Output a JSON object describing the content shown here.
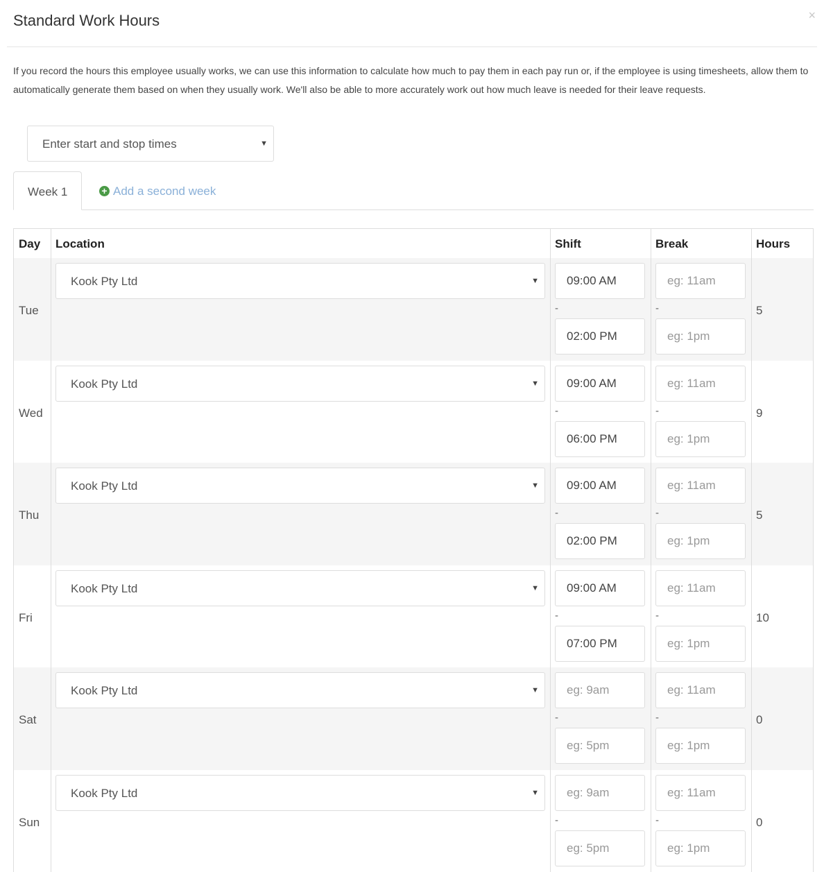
{
  "modal": {
    "title": "Standard Work Hours",
    "close_icon": "×",
    "description": "If you record the hours this employee usually works, we can use this information to calculate how much to pay them in each pay run or, if the employee is using timesheets, allow them to automatically generate them based on when they usually work. We'll also be able to more accurately work out how much leave is needed for their leave requests."
  },
  "entry_mode": {
    "selected": "Enter start and stop times",
    "icon": "caret-down-icon"
  },
  "tabs": {
    "week1": "Week 1",
    "add_week": "Add a second week",
    "add_icon": "plus-circle-icon",
    "add_color": "#8ab0d8"
  },
  "table": {
    "headers": {
      "day": "Day",
      "location": "Location",
      "shift": "Shift",
      "break": "Break",
      "hours": "Hours"
    },
    "break_start_placeholder": "eg: 11am",
    "break_end_placeholder": "eg: 1pm",
    "shift_start_placeholder": "eg: 9am",
    "shift_end_placeholder": "eg: 5pm",
    "rows": [
      {
        "day": "Tue",
        "location": "Kook Pty Ltd",
        "shift_start": "09:00 AM",
        "shift_end": "02:00 PM",
        "hours": "5"
      },
      {
        "day": "Wed",
        "location": "Kook Pty Ltd",
        "shift_start": "09:00 AM",
        "shift_end": "06:00 PM",
        "hours": "9"
      },
      {
        "day": "Thu",
        "location": "Kook Pty Ltd",
        "shift_start": "09:00 AM",
        "shift_end": "02:00 PM",
        "hours": "5"
      },
      {
        "day": "Fri",
        "location": "Kook Pty Ltd",
        "shift_start": "09:00 AM",
        "shift_end": "07:00 PM",
        "hours": "10"
      },
      {
        "day": "Sat",
        "location": "Kook Pty Ltd",
        "shift_start": "",
        "shift_end": "",
        "hours": "0"
      },
      {
        "day": "Sun",
        "location": "Kook Pty Ltd",
        "shift_start": "",
        "shift_end": "",
        "hours": "0"
      }
    ]
  }
}
